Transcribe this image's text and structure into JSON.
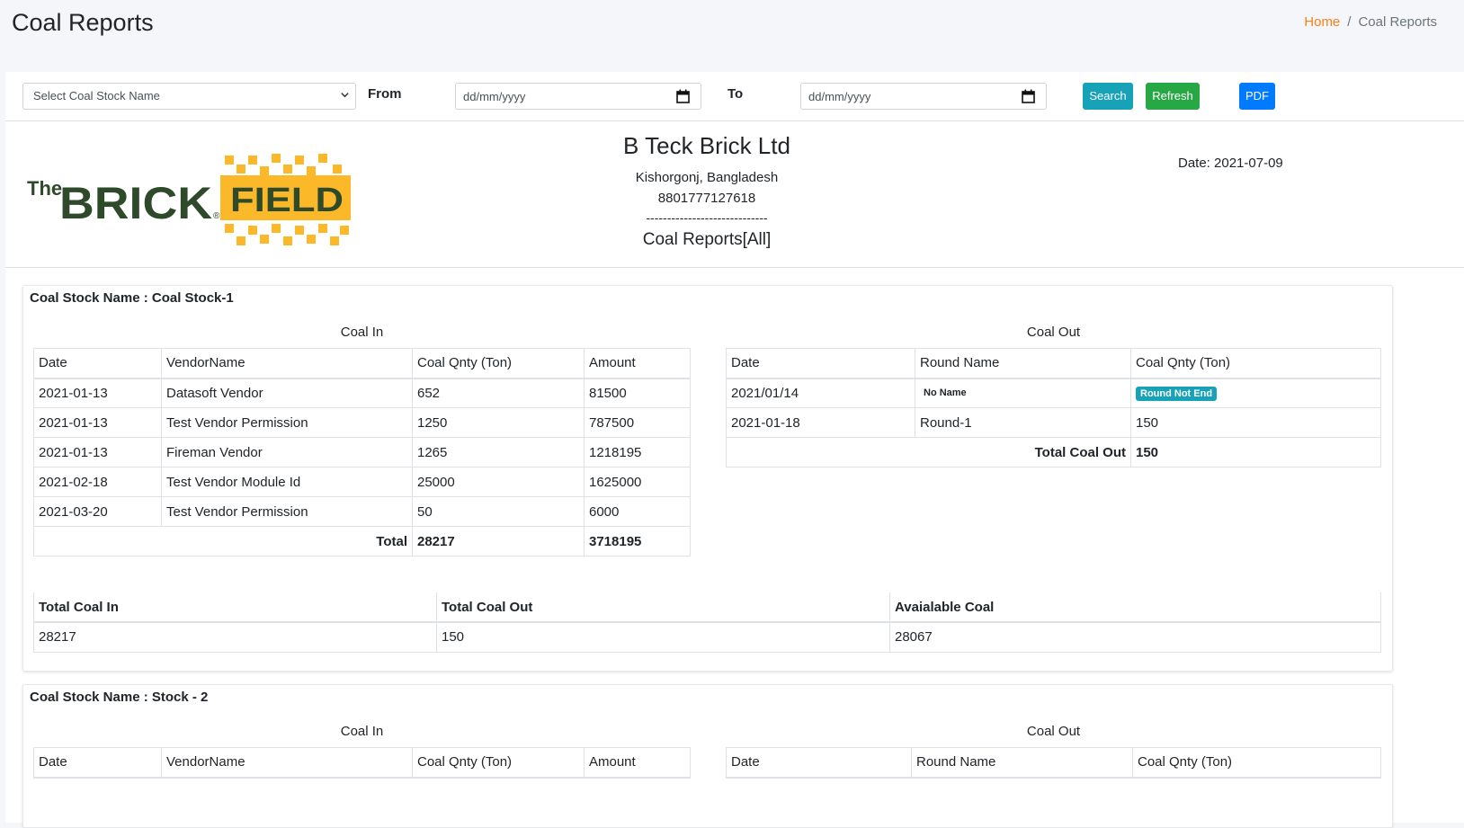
{
  "page": {
    "title": "Coal Reports",
    "breadcrumb": {
      "home": "Home",
      "separator": "/",
      "current": "Coal Reports"
    }
  },
  "filters": {
    "stock_select": "Select Coal Stock Name",
    "from_label": "From",
    "to_label": "To",
    "from_placeholder": "dd/mm/yyyy",
    "to_placeholder": "dd/mm/yyyy",
    "search_label": "Search",
    "refresh_label": "Refresh",
    "pdf_label": "PDF"
  },
  "report": {
    "company_name": "B Teck Brick Ltd",
    "address": "Kishorgonj, Bangladesh",
    "phone": "8801777127618",
    "dash": "-----------------------------",
    "report_title": "Coal Reports[All]",
    "date_text": "Date: 2021-07-09",
    "logo": {
      "text_the": "The",
      "text_brick": "BRICK",
      "text_field": "FIELD",
      "reg": "®"
    }
  },
  "colors": {
    "search": "#17a2b8",
    "refresh": "#28a745",
    "pdf": "#007bff",
    "home_link": "#fd7e14",
    "logo_green": "#2e4a2b",
    "logo_yellow": "#fbb829"
  },
  "stocks": [
    {
      "title": "Coal Stock Name : Coal Stock-1",
      "coal_in_caption": "Coal In",
      "coal_out_caption": "Coal Out",
      "in_headers": [
        "Date",
        "VendorName",
        "Coal Qnty (Ton)",
        "Amount"
      ],
      "in_rows": [
        [
          "2021-01-13",
          "Datasoft Vendor",
          "652",
          "81500"
        ],
        [
          "2021-01-13",
          "Test Vendor Permission",
          "1250",
          "787500"
        ],
        [
          "2021-01-13",
          "Fireman Vendor",
          "1265",
          "1218195"
        ],
        [
          "2021-02-18",
          "Test Vendor Module Id",
          "25000",
          "1625000"
        ],
        [
          "2021-03-20",
          "Test Vendor Permission",
          "50",
          "6000"
        ]
      ],
      "in_total_label": "Total",
      "in_total_qty": "28217",
      "in_total_amount": "3718195",
      "out_headers": [
        "Date",
        "Round Name",
        "Coal Qnty (Ton)"
      ],
      "out_rows": [
        {
          "date": "2021/01/14",
          "round": "No Name",
          "qty": "Round Not End"
        },
        {
          "date": "2021-01-18",
          "round": "Round-1",
          "qty": "150"
        }
      ],
      "out_total_label": "Total Coal Out",
      "out_total_qty": "150",
      "summary_headers": [
        "Total Coal In",
        "Total Coal Out",
        "Avaialable Coal"
      ],
      "summary_values": [
        "28217",
        "150",
        "28067"
      ]
    },
    {
      "title": "Coal Stock Name : Stock - 2",
      "coal_in_caption": "Coal In",
      "coal_out_caption": "Coal Out",
      "in_headers": [
        "Date",
        "VendorName",
        "Coal Qnty (Ton)",
        "Amount"
      ],
      "out_headers": [
        "Date",
        "Round Name",
        "Coal Qnty (Ton)"
      ]
    }
  ]
}
